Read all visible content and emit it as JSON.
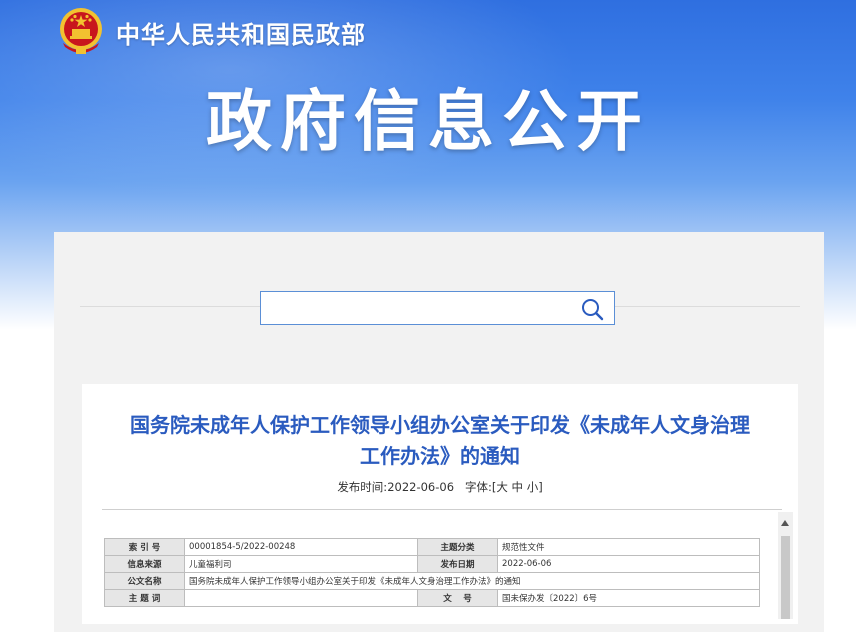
{
  "header": {
    "ministry_name": "中华人民共和国民政部",
    "banner_title": "政府信息公开"
  },
  "search": {
    "placeholder": "",
    "value": ""
  },
  "article": {
    "title_line1": "国务院未成年人保护工作领导小组办公室关于印发《未成年人文身治理",
    "title_line2": "工作办法》的通知",
    "publish_label": "发布时间:",
    "publish_date": "2022-06-06",
    "font_label": "字体:",
    "font_open": "[",
    "font_large": "大",
    "font_medium": "中",
    "font_small": "小",
    "font_close": "]"
  },
  "info_table": {
    "index_no_label": "索 引 号",
    "index_no": "00001854-5/2022-00248",
    "topic_label": "主题分类",
    "topic": "规范性文件",
    "source_label": "信息来源",
    "source": "儿童福利司",
    "date_label": "发布日期",
    "date": "2022-06-06",
    "doc_name_label": "公文名称",
    "doc_name": "国务院未成年人保护工作领导小组办公室关于印发《未成年人文身治理工作办法》的通知",
    "keywords_label": "主 题 词",
    "keywords": "",
    "doc_no_label": "文　 号",
    "doc_no": "国未保办发〔2022〕6号"
  },
  "colors": {
    "banner_blue": "#3f82ea",
    "title_blue": "#2a5bbf",
    "emblem_red": "#c8161d",
    "emblem_gold": "#f2c230"
  },
  "icons": {
    "emblem": "national-emblem-icon",
    "search": "search-icon",
    "scroll_up": "scroll-up-arrow-icon"
  }
}
